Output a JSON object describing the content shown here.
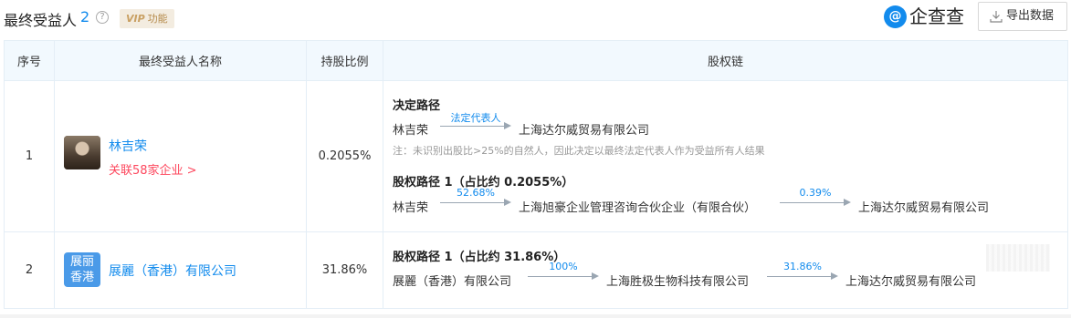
{
  "header": {
    "title": "最终受益人",
    "count": "2",
    "help_symbol": "?",
    "vip_prefix": "VIP",
    "vip_text": "功能",
    "brand_symbol": "@",
    "brand_name": "企查查",
    "export_label": "导出数据"
  },
  "table": {
    "columns": [
      "序号",
      "最终受益人名称",
      "持股比例",
      "股权链"
    ],
    "rows": [
      {
        "index": "1",
        "name": "林吉荣",
        "link": "关联58家企业 >",
        "ratio": "0.2055%",
        "paths": [
          {
            "title": "决定路径",
            "from": "林吉荣",
            "edge": "法定代表人",
            "to": "上海达尔威贸易有限公司",
            "note": "注：未识别出股比>25%的自然人，因此决定以最终法定代表人作为受益所有人结果"
          },
          {
            "title": "股权路径 1（占比约 0.2055%）",
            "from": "林吉荣",
            "edge1": "52.68%",
            "mid": "上海旭豪企业管理咨询合伙企业（有限合伙）",
            "edge2": "0.39%",
            "to": "上海达尔威贸易有限公司"
          }
        ]
      },
      {
        "index": "2",
        "name": "展麗（香港）有限公司",
        "logo_line1": "展丽",
        "logo_line2": "香港",
        "ratio": "31.86%",
        "paths": [
          {
            "title": "股权路径 1（占比约 31.86%）",
            "from": "展麗（香港）有限公司",
            "edge1": "100%",
            "mid": "上海胜极生物科技有限公司",
            "edge2": "31.86%",
            "to": "上海达尔威贸易有限公司"
          }
        ]
      }
    ]
  },
  "colors": {
    "accent": "#128bed",
    "link_red": "#fd485e",
    "header_bg": "#f2f9fe",
    "vip_bg": "#f3ece0"
  }
}
